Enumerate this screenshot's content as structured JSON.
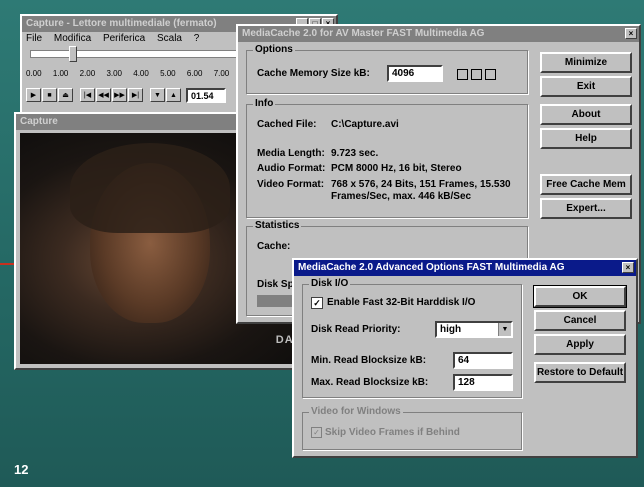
{
  "page_number": "12",
  "capture_window": {
    "title": "Capture - Lettore multimediale (fermato)",
    "menu": [
      "File",
      "Modifica",
      "Periferica",
      "Scala",
      "?"
    ],
    "ticks": [
      "0.00",
      "1.00",
      "2.00",
      "3.00",
      "4.00",
      "5.00",
      "6.00",
      "7.00"
    ],
    "time_display": "01.54",
    "transport_icons": [
      "play-icon",
      "stop-icon",
      "eject-icon",
      "skip-start-icon",
      "rewind-icon",
      "fast-forward-icon",
      "skip-end-icon",
      "mark-in-icon",
      "mark-out-icon"
    ]
  },
  "video_window": {
    "title": "Capture",
    "overlay_text": "DAE"
  },
  "mediacache_window": {
    "title": "MediaCache 2.0 for AV Master   FAST Multimedia AG",
    "options_label": "Options",
    "cache_memory_label": "Cache Memory Size  kB:",
    "cache_memory_value": "4096",
    "info_label": "Info",
    "cached_file_label": "Cached File:",
    "cached_file_value": "C:\\Capture.avi",
    "media_length_label": "Media Length:",
    "media_length_value": "9.723 sec.",
    "audio_format_label": "Audio Format:",
    "audio_format_value": "PCM 8000 Hz, 16 bit, Stereo",
    "video_format_label": "Video Format:",
    "video_format_value_1": "768 x 576, 24 Bits, 151 Frames, 15.530",
    "video_format_value_2": "Frames/Sec, max. 446 kB/Sec",
    "statistics_label": "Statistics",
    "cache_label": "Cache:",
    "disk_label": "Disk Sp",
    "buttons": {
      "minimize": "Minimize",
      "exit": "Exit",
      "about": "About",
      "help": "Help",
      "free_cache": "Free Cache Mem",
      "expert": "Expert..."
    }
  },
  "advanced_window": {
    "title": "MediaCache 2.0   Advanced Options   FAST Multimedia AG",
    "disk_io_label": "Disk I/O",
    "enable_fast_label": "Enable Fast 32-Bit Harddisk I/O",
    "disk_read_priority_label": "Disk Read Priority:",
    "disk_read_priority_value": "high",
    "min_read_label": "Min. Read Blocksize  kB:",
    "min_read_value": "64",
    "max_read_label": "Max. Read Blocksize  kB:",
    "max_read_value": "128",
    "vfw_label": "Video for Windows",
    "skip_frames_label": "Skip Video Frames if Behind",
    "buttons": {
      "ok": "OK",
      "cancel": "Cancel",
      "apply": "Apply",
      "restore": "Restore to Default"
    }
  }
}
